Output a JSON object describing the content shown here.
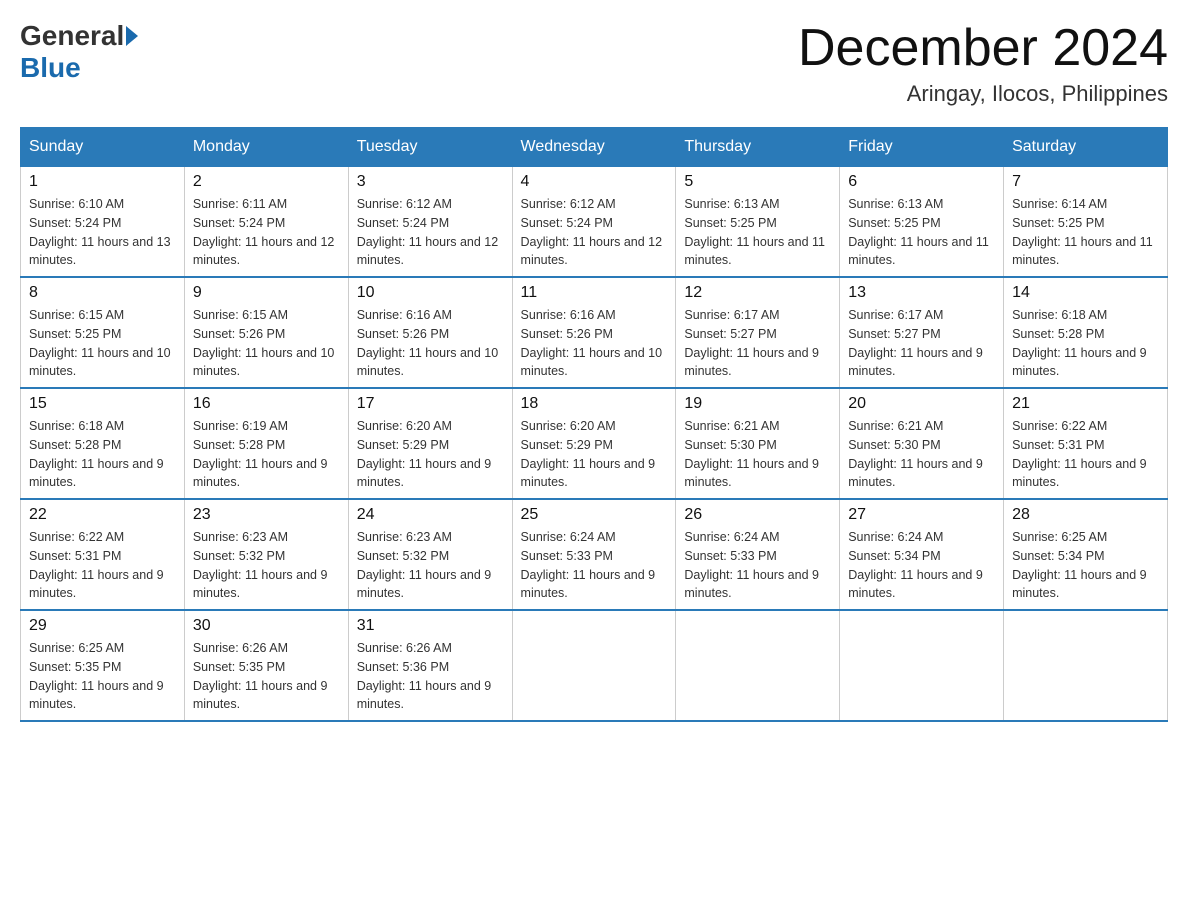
{
  "header": {
    "logo_general": "General",
    "logo_blue": "Blue",
    "month_title": "December 2024",
    "location": "Aringay, Ilocos, Philippines"
  },
  "weekdays": [
    "Sunday",
    "Monday",
    "Tuesday",
    "Wednesday",
    "Thursday",
    "Friday",
    "Saturday"
  ],
  "weeks": [
    [
      {
        "day": "1",
        "sunrise": "6:10 AM",
        "sunset": "5:24 PM",
        "daylight": "11 hours and 13 minutes."
      },
      {
        "day": "2",
        "sunrise": "6:11 AM",
        "sunset": "5:24 PM",
        "daylight": "11 hours and 12 minutes."
      },
      {
        "day": "3",
        "sunrise": "6:12 AM",
        "sunset": "5:24 PM",
        "daylight": "11 hours and 12 minutes."
      },
      {
        "day": "4",
        "sunrise": "6:12 AM",
        "sunset": "5:24 PM",
        "daylight": "11 hours and 12 minutes."
      },
      {
        "day": "5",
        "sunrise": "6:13 AM",
        "sunset": "5:25 PM",
        "daylight": "11 hours and 11 minutes."
      },
      {
        "day": "6",
        "sunrise": "6:13 AM",
        "sunset": "5:25 PM",
        "daylight": "11 hours and 11 minutes."
      },
      {
        "day": "7",
        "sunrise": "6:14 AM",
        "sunset": "5:25 PM",
        "daylight": "11 hours and 11 minutes."
      }
    ],
    [
      {
        "day": "8",
        "sunrise": "6:15 AM",
        "sunset": "5:25 PM",
        "daylight": "11 hours and 10 minutes."
      },
      {
        "day": "9",
        "sunrise": "6:15 AM",
        "sunset": "5:26 PM",
        "daylight": "11 hours and 10 minutes."
      },
      {
        "day": "10",
        "sunrise": "6:16 AM",
        "sunset": "5:26 PM",
        "daylight": "11 hours and 10 minutes."
      },
      {
        "day": "11",
        "sunrise": "6:16 AM",
        "sunset": "5:26 PM",
        "daylight": "11 hours and 10 minutes."
      },
      {
        "day": "12",
        "sunrise": "6:17 AM",
        "sunset": "5:27 PM",
        "daylight": "11 hours and 9 minutes."
      },
      {
        "day": "13",
        "sunrise": "6:17 AM",
        "sunset": "5:27 PM",
        "daylight": "11 hours and 9 minutes."
      },
      {
        "day": "14",
        "sunrise": "6:18 AM",
        "sunset": "5:28 PM",
        "daylight": "11 hours and 9 minutes."
      }
    ],
    [
      {
        "day": "15",
        "sunrise": "6:18 AM",
        "sunset": "5:28 PM",
        "daylight": "11 hours and 9 minutes."
      },
      {
        "day": "16",
        "sunrise": "6:19 AM",
        "sunset": "5:28 PM",
        "daylight": "11 hours and 9 minutes."
      },
      {
        "day": "17",
        "sunrise": "6:20 AM",
        "sunset": "5:29 PM",
        "daylight": "11 hours and 9 minutes."
      },
      {
        "day": "18",
        "sunrise": "6:20 AM",
        "sunset": "5:29 PM",
        "daylight": "11 hours and 9 minutes."
      },
      {
        "day": "19",
        "sunrise": "6:21 AM",
        "sunset": "5:30 PM",
        "daylight": "11 hours and 9 minutes."
      },
      {
        "day": "20",
        "sunrise": "6:21 AM",
        "sunset": "5:30 PM",
        "daylight": "11 hours and 9 minutes."
      },
      {
        "day": "21",
        "sunrise": "6:22 AM",
        "sunset": "5:31 PM",
        "daylight": "11 hours and 9 minutes."
      }
    ],
    [
      {
        "day": "22",
        "sunrise": "6:22 AM",
        "sunset": "5:31 PM",
        "daylight": "11 hours and 9 minutes."
      },
      {
        "day": "23",
        "sunrise": "6:23 AM",
        "sunset": "5:32 PM",
        "daylight": "11 hours and 9 minutes."
      },
      {
        "day": "24",
        "sunrise": "6:23 AM",
        "sunset": "5:32 PM",
        "daylight": "11 hours and 9 minutes."
      },
      {
        "day": "25",
        "sunrise": "6:24 AM",
        "sunset": "5:33 PM",
        "daylight": "11 hours and 9 minutes."
      },
      {
        "day": "26",
        "sunrise": "6:24 AM",
        "sunset": "5:33 PM",
        "daylight": "11 hours and 9 minutes."
      },
      {
        "day": "27",
        "sunrise": "6:24 AM",
        "sunset": "5:34 PM",
        "daylight": "11 hours and 9 minutes."
      },
      {
        "day": "28",
        "sunrise": "6:25 AM",
        "sunset": "5:34 PM",
        "daylight": "11 hours and 9 minutes."
      }
    ],
    [
      {
        "day": "29",
        "sunrise": "6:25 AM",
        "sunset": "5:35 PM",
        "daylight": "11 hours and 9 minutes."
      },
      {
        "day": "30",
        "sunrise": "6:26 AM",
        "sunset": "5:35 PM",
        "daylight": "11 hours and 9 minutes."
      },
      {
        "day": "31",
        "sunrise": "6:26 AM",
        "sunset": "5:36 PM",
        "daylight": "11 hours and 9 minutes."
      },
      null,
      null,
      null,
      null
    ]
  ]
}
